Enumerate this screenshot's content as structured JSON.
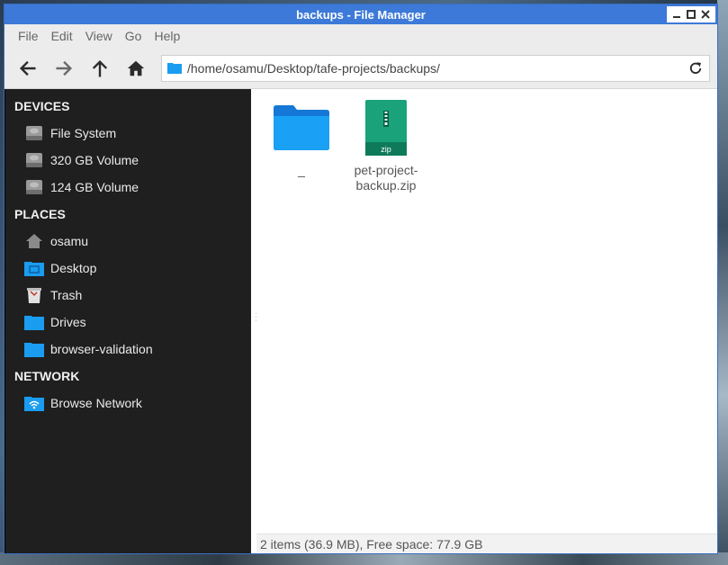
{
  "window": {
    "title": "backups - File Manager",
    "controls": [
      "minimize",
      "maximize",
      "close"
    ]
  },
  "menu": {
    "items": [
      "File",
      "Edit",
      "View",
      "Go",
      "Help"
    ]
  },
  "toolbar": {
    "path": "/home/osamu/Desktop/tafe-projects/backups/"
  },
  "sidebar": {
    "devices_title": "DEVICES",
    "devices": [
      {
        "label": "File System",
        "icon": "drive-icon"
      },
      {
        "label": "320 GB Volume",
        "icon": "drive-icon"
      },
      {
        "label": "124 GB Volume",
        "icon": "drive-icon"
      }
    ],
    "places_title": "PLACES",
    "places": [
      {
        "label": "osamu",
        "icon": "home-icon"
      },
      {
        "label": "Desktop",
        "icon": "desktop-folder-icon"
      },
      {
        "label": "Trash",
        "icon": "trash-icon"
      },
      {
        "label": "Drives",
        "icon": "drives-folder-icon"
      },
      {
        "label": "browser-validation",
        "icon": "folder-icon"
      }
    ],
    "network_title": "NETWORK",
    "network": [
      {
        "label": "Browse Network",
        "icon": "network-folder-icon"
      }
    ]
  },
  "files": [
    {
      "name": "_",
      "icon": "folder-icon"
    },
    {
      "name": "pet-project-backup.zip",
      "icon": "zip-icon",
      "badge": "zip"
    }
  ],
  "status": {
    "text": "2 items (36.9 MB), Free space: 77.9 GB"
  },
  "colors": {
    "titlebar": "#3c79d8",
    "sidebar": "#1f1f1f",
    "folder": "#1a9cf0",
    "zip": "#1aa37a"
  }
}
